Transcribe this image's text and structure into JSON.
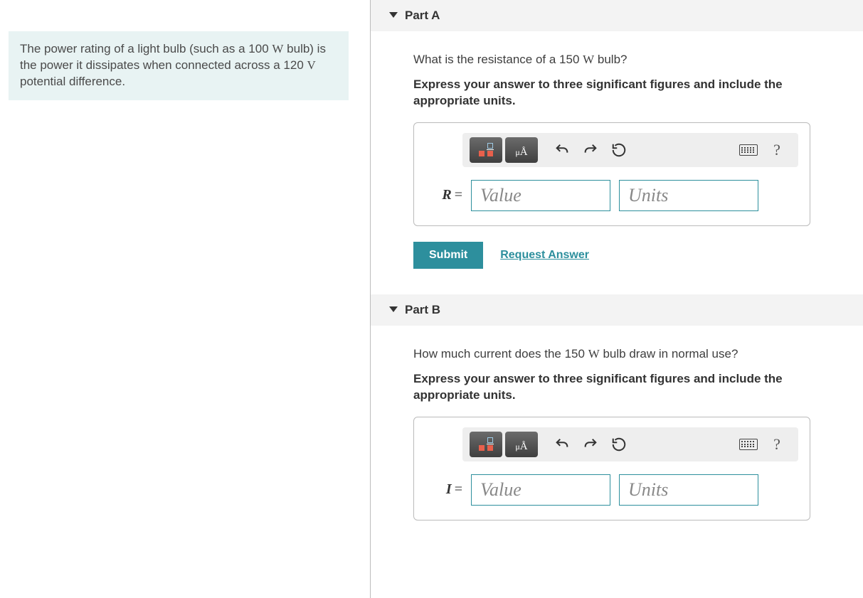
{
  "problem": {
    "text_pre": "The power rating of a light bulb (such as a 100 ",
    "unit1": "W",
    "text_mid": " bulb) is the power it dissipates when connected across a 120 ",
    "unit2": "V",
    "text_post": " potential difference."
  },
  "partA": {
    "title": "Part A",
    "question_pre": "What is the resistance of a 150 ",
    "question_unit": "W",
    "question_post": " bulb?",
    "instruction": "Express your answer to three significant figures and include the appropriate units.",
    "variable": "R",
    "value_placeholder": "Value",
    "units_placeholder": "Units",
    "submit_label": "Submit",
    "request_label": "Request Answer"
  },
  "partB": {
    "title": "Part B",
    "question_pre": "How much current does the 150 ",
    "question_unit": "W",
    "question_post": " bulb draw in normal use?",
    "instruction": "Express your answer to three significant figures and include the appropriate units.",
    "variable": "I",
    "value_placeholder": "Value",
    "units_placeholder": "Units"
  },
  "toolbar": {
    "help": "?"
  }
}
